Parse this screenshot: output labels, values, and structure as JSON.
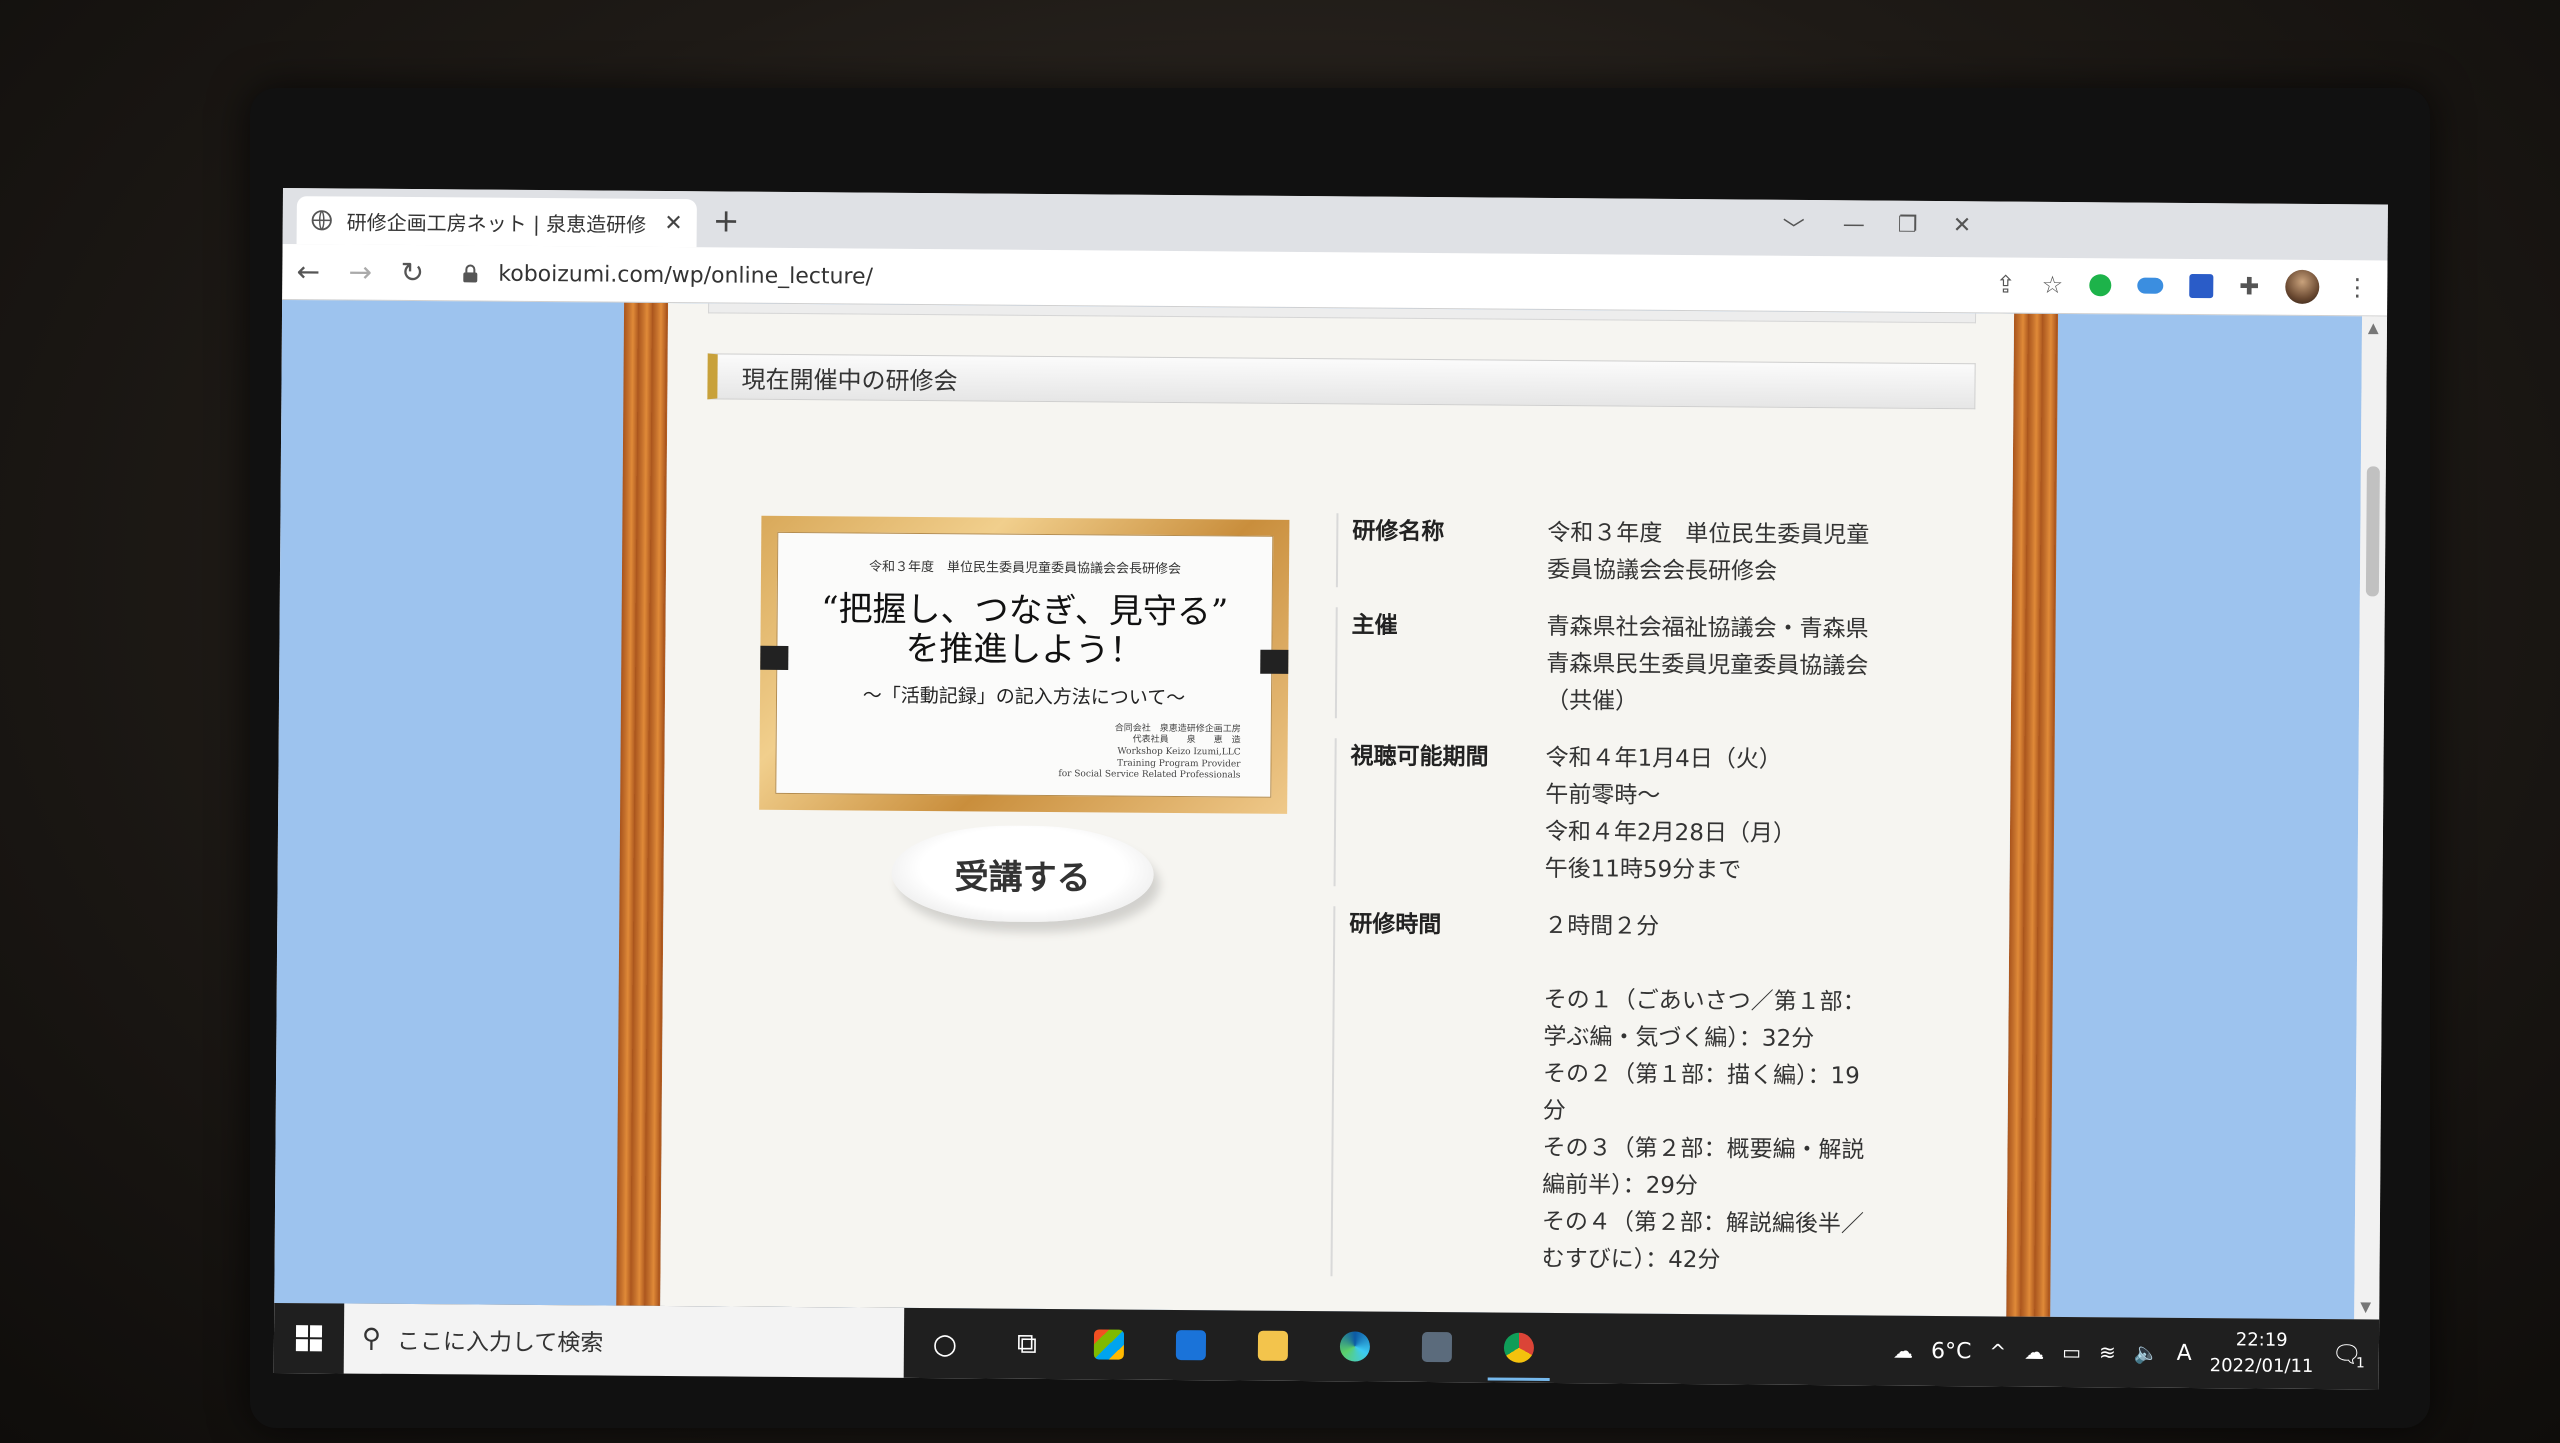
{
  "browser": {
    "tab_title": "研修企画工房ネット | 泉恵造研修",
    "tab_close": "✕",
    "new_tab": "+",
    "url": "koboizumi.com/wp/online_lecture/",
    "win_controls": [
      "﹀",
      "—",
      "❐",
      "✕"
    ]
  },
  "page": {
    "section_title": "現在開催中の研修会",
    "certificate": {
      "line1": "令和３年度　単位民生委員児童委員協議会会長研修会",
      "line2": "“把握し、つなぎ、見守る”\nを推進しよう！",
      "line3": "～「活動記録」の記入方法について～",
      "sig": "合同会社　泉恵造研修企画工房\n代表社員　　泉　　恵　造\nWorkshop Keizo Izumi,LLC\nTraining Program Provider\nfor Social Service Related Professionals"
    },
    "enroll_button": "受講する",
    "info": [
      {
        "key": "研修名称",
        "value": "令和３年度　単位民生委員児童\n委員協議会会長研修会"
      },
      {
        "key": "主催",
        "value": "青森県社会福祉協議会・青森県\n青森県民生委員児童委員協議会\n（共催）"
      },
      {
        "key": "視聴可能期間",
        "value": "令和４年1月4日（火）\n午前零時～\n令和４年2月28日（月）\n午後11時59分まで"
      },
      {
        "key": "研修時間",
        "value": "２時間２分\n\nその１（ごあいさつ／第１部：\n学ぶ編・気づく編）：32分\nその２（第１部：描く編）：19\n分\nその３（第２部：概要編・解説\n編前半）：29分\nその４（第２部：解説編後半／\nむすびに）：42分"
      }
    ]
  },
  "taskbar": {
    "search_placeholder": "ここに入力して検索",
    "weather": "6°C",
    "ime": "A",
    "time": "22:19",
    "date": "2022/01/11",
    "notif_count": "1"
  },
  "colors": {
    "page_bg": "#9dc3ee",
    "wood": "#c4702c",
    "accent_bar": "#c8a13a"
  }
}
